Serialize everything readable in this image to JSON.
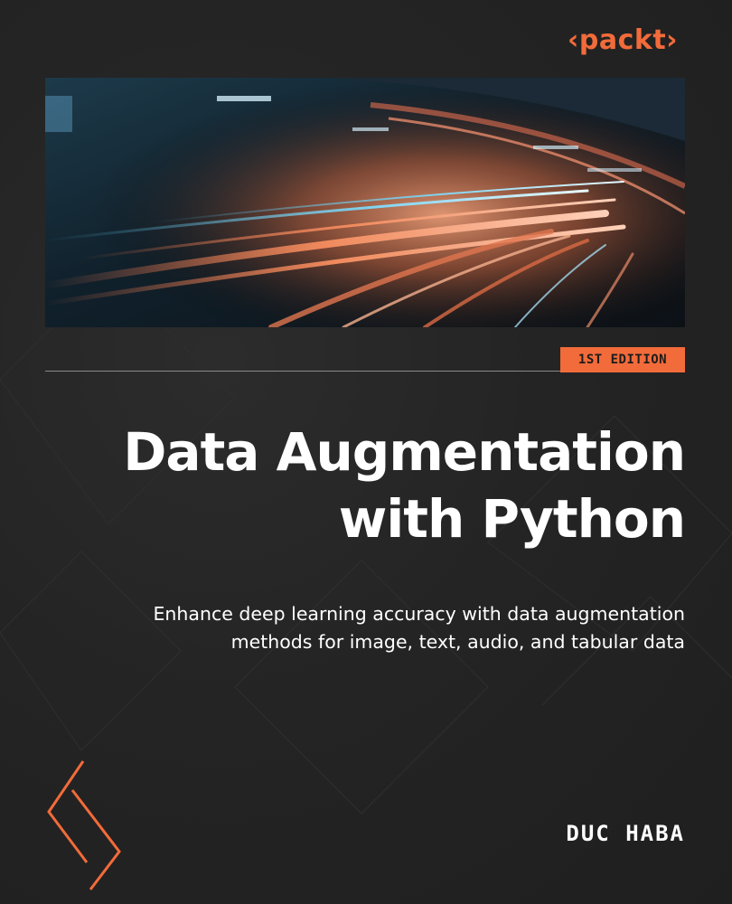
{
  "publisher": {
    "logo_text": "packt"
  },
  "edition": "1ST EDITION",
  "title_lines": [
    "Data Augmentation",
    "with Python"
  ],
  "subtitle_lines": [
    "Enhance deep learning accuracy with data augmentation",
    "methods for image, text, audio, and tabular data"
  ],
  "author": "DUC HABA",
  "colors": {
    "background": "#232323",
    "accent": "#f26b3a",
    "title": "#ffffff"
  },
  "icons": [
    "chevron-right-icon"
  ]
}
